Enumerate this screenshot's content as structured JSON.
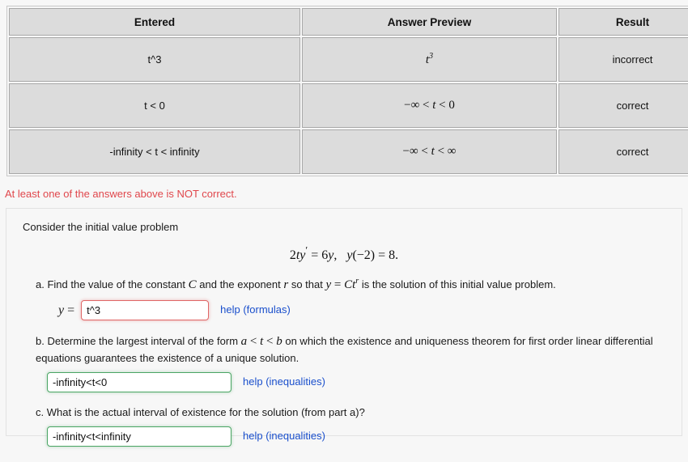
{
  "results_table": {
    "headers": [
      "Entered",
      "Answer Preview",
      "Result"
    ],
    "rows": [
      {
        "entered": "t^3",
        "preview_plain": "t^3",
        "result": "incorrect",
        "result_state": "incorrect"
      },
      {
        "entered": "t < 0",
        "preview_plain": "-∞ < t < 0",
        "result": "correct",
        "result_state": "correct"
      },
      {
        "entered": "-infinity < t < infinity",
        "preview_plain": "-∞ < t < ∞",
        "result": "correct",
        "result_state": "correct"
      }
    ]
  },
  "warning": {
    "text": "At least one of the answers above is NOT correct."
  },
  "problem": {
    "intro": "Consider the initial value problem",
    "equation_plain": "2ty' = 6y,   y(-2) = 8.",
    "parts": [
      {
        "label": "a.",
        "text_pre": "Find the value of the constant ",
        "text_mid1": " and the exponent ",
        "text_mid2": " so that ",
        "text_post": " is the solution of this initial value problem.",
        "prefix_label": "y =",
        "input_value": "t^3",
        "help_label": "help (formulas)",
        "state": "incorrect"
      },
      {
        "label": "b.",
        "text_pre": "Determine the largest interval of the form ",
        "text_post": " on which the existence and uniqueness theorem for first order linear differential equations guarantees the existence of a unique solution.",
        "input_value": "-infinity<t<0",
        "help_label": "help (inequalities)",
        "state": "correct"
      },
      {
        "label": "c.",
        "text_full": "What is the actual interval of existence for the solution (from part a)?",
        "input_value": "-infinity<t<infinity",
        "help_label": "help (inequalities)",
        "state": "correct"
      }
    ]
  },
  "colors": {
    "incorrect_bg": "#dd8c8c",
    "correct_bg": "#22ee99",
    "result_text": "#12348a",
    "warning_text": "#e0474c",
    "link": "#1a4fcc",
    "cell_bg": "#dcdcdc",
    "page_bg": "#f7f7f7",
    "input_border_wrong": "#e06666",
    "input_border_right": "#4aa564"
  }
}
